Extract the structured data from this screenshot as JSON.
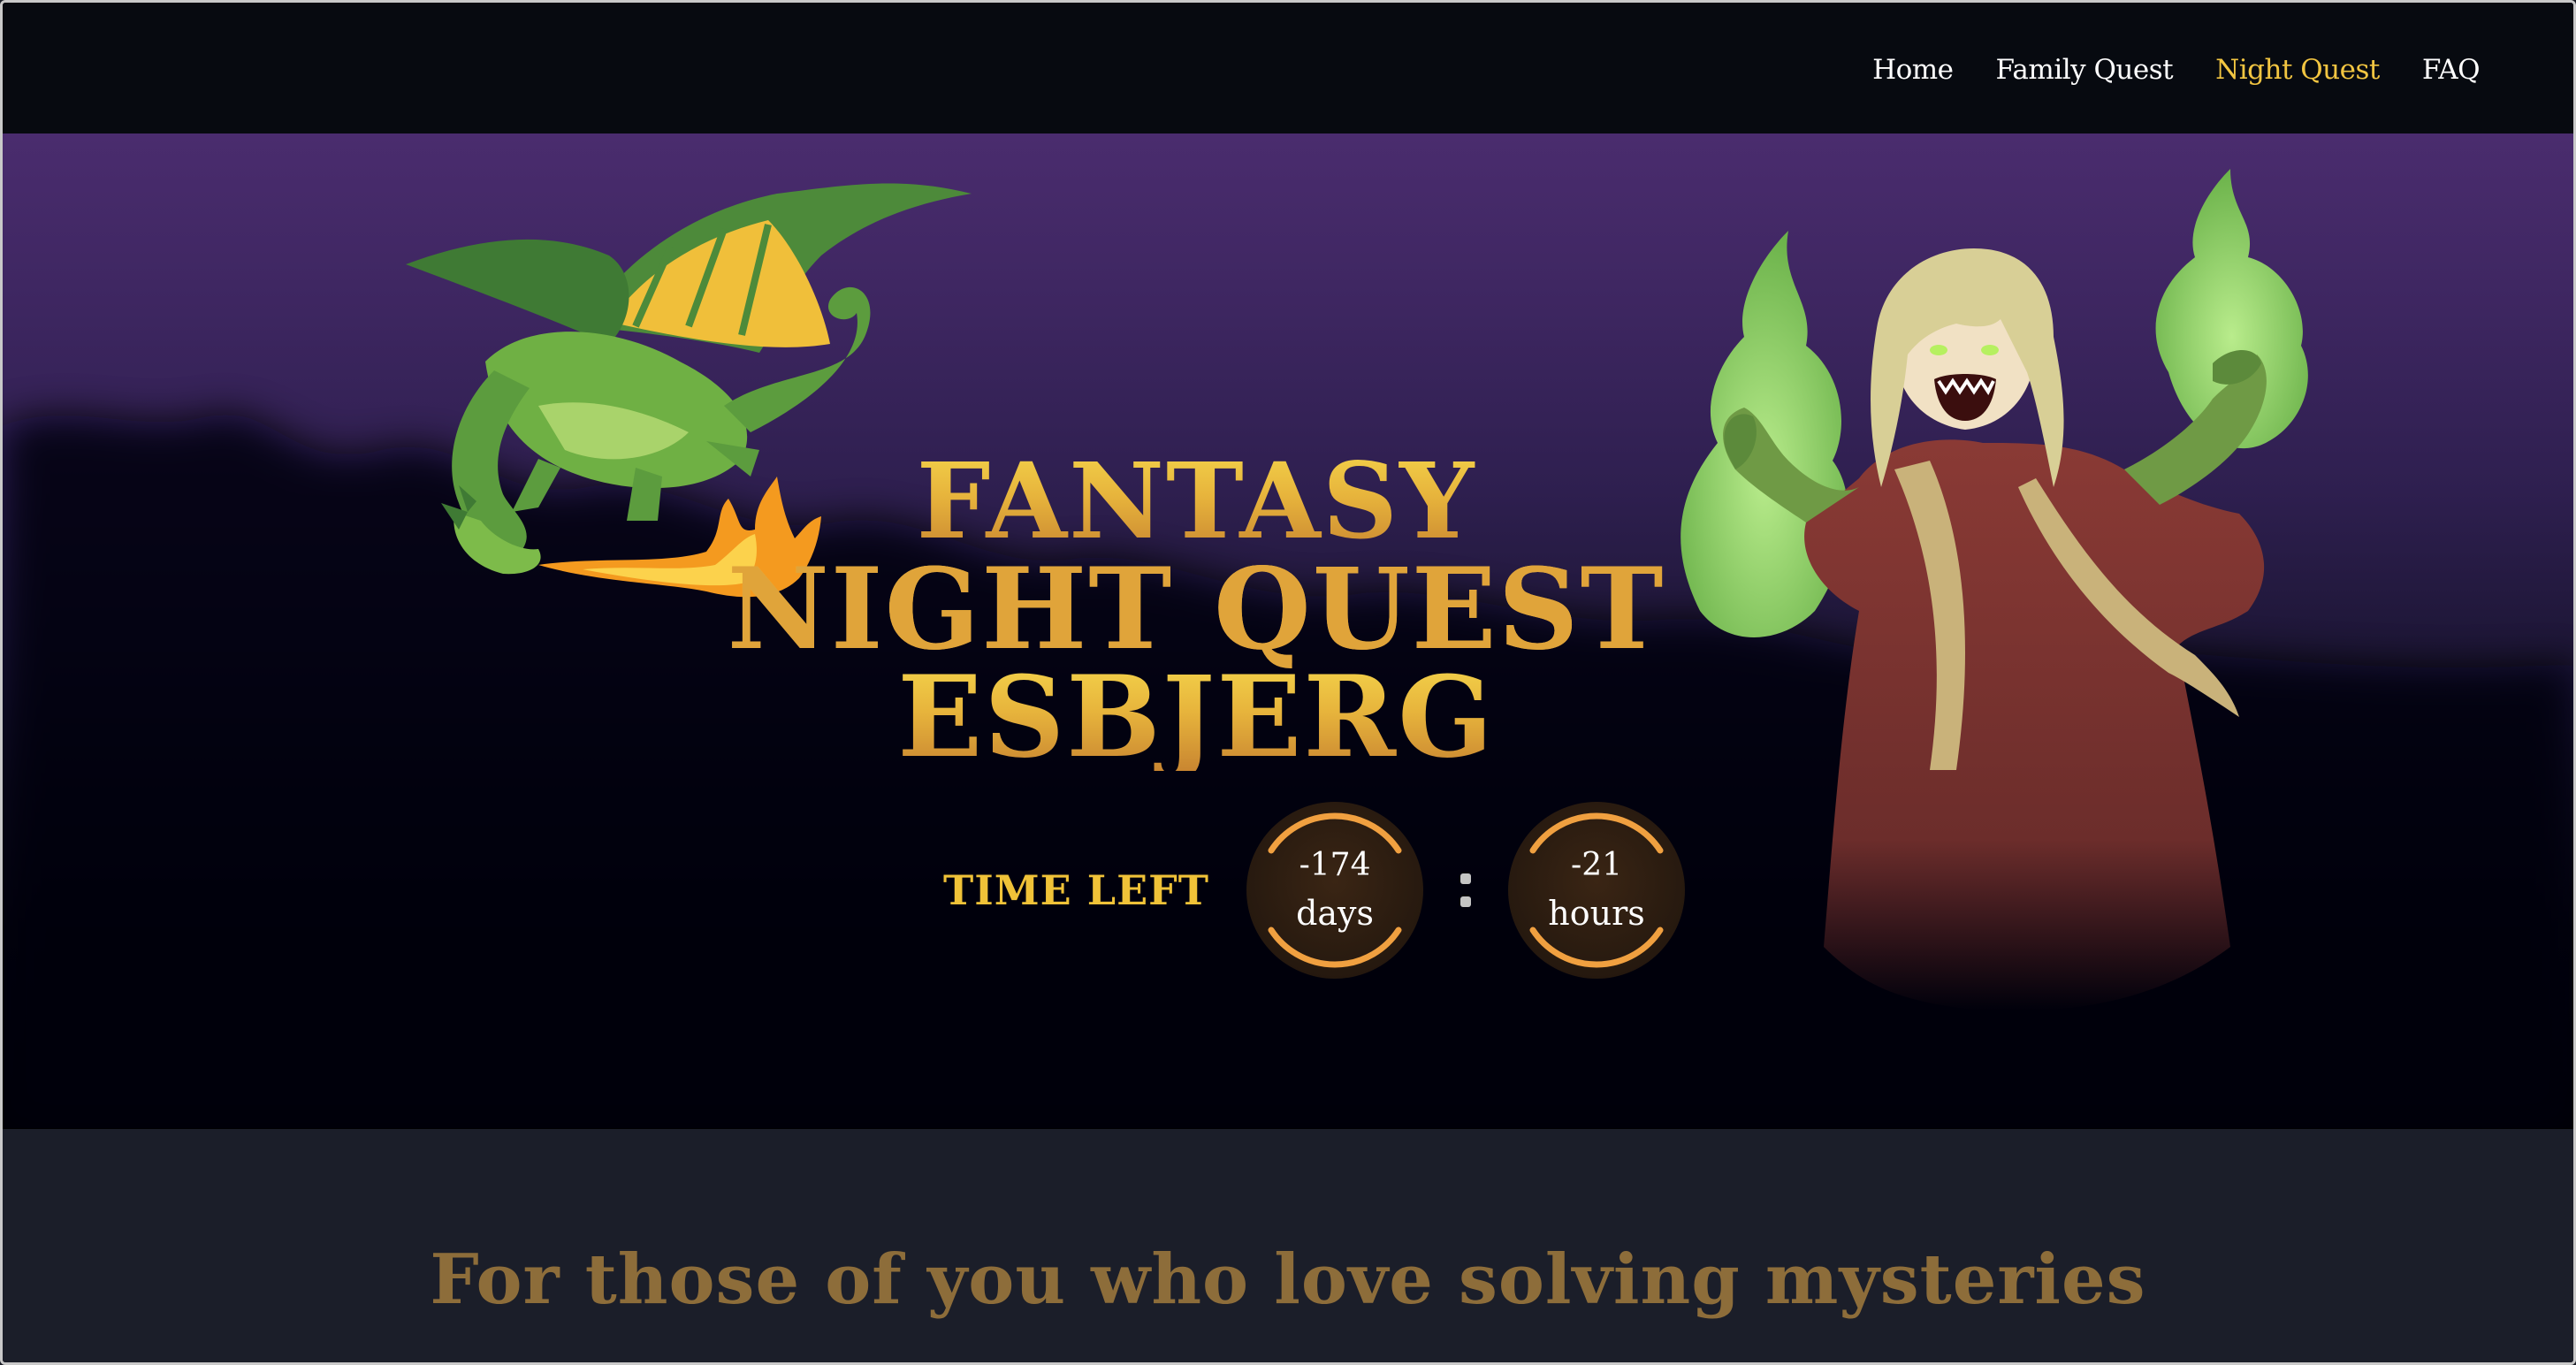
{
  "nav": {
    "items": [
      {
        "label": "Home",
        "active": false
      },
      {
        "label": "Family Quest",
        "active": false
      },
      {
        "label": "Night Quest",
        "active": true
      },
      {
        "label": "FAQ",
        "active": false
      }
    ],
    "active_color": "#f2c541"
  },
  "hero": {
    "title_lines": [
      "FANTASY",
      "NIGHT QUEST",
      "ESBJERG"
    ],
    "countdown": {
      "label": "TIME LEFT",
      "days": {
        "value": "-174",
        "unit": "days"
      },
      "hours": {
        "value": "-21",
        "unit": "hours"
      }
    },
    "illustrations": [
      "dragon-illustration",
      "witch-illustration"
    ]
  },
  "tagline": "For those of you who love solving mysteries",
  "colors": {
    "header_bg": "#070a10",
    "title_gold": "#e7b43c",
    "countdown_ring": "#f0a040",
    "tagline": "#8d6d3a",
    "band_bg": "#1b1e29"
  }
}
